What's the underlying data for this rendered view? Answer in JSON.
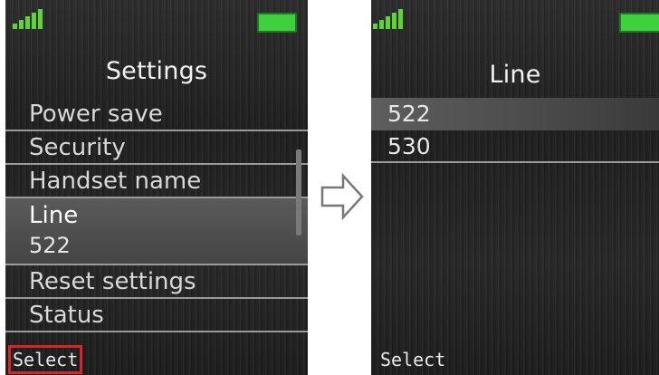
{
  "left_screen": {
    "title": "Settings",
    "items": [
      {
        "label": "Power save"
      },
      {
        "label": "Security"
      },
      {
        "label": "Handset name"
      },
      {
        "label": "Line",
        "value": "522"
      },
      {
        "label": "Reset settings"
      },
      {
        "label": "Status"
      }
    ],
    "selected_index": 3,
    "softkey": "Select"
  },
  "right_screen": {
    "title": "Line",
    "items": [
      {
        "label": "522"
      },
      {
        "label": "530"
      }
    ],
    "selected_index": 0,
    "softkey": "Select"
  },
  "colors": {
    "signal": "#5fd33a",
    "battery": "#3fcf3f",
    "highlight_box": "#d6262b"
  },
  "icons": [
    "signal-strength-icon",
    "battery-icon",
    "right-arrow-icon"
  ]
}
